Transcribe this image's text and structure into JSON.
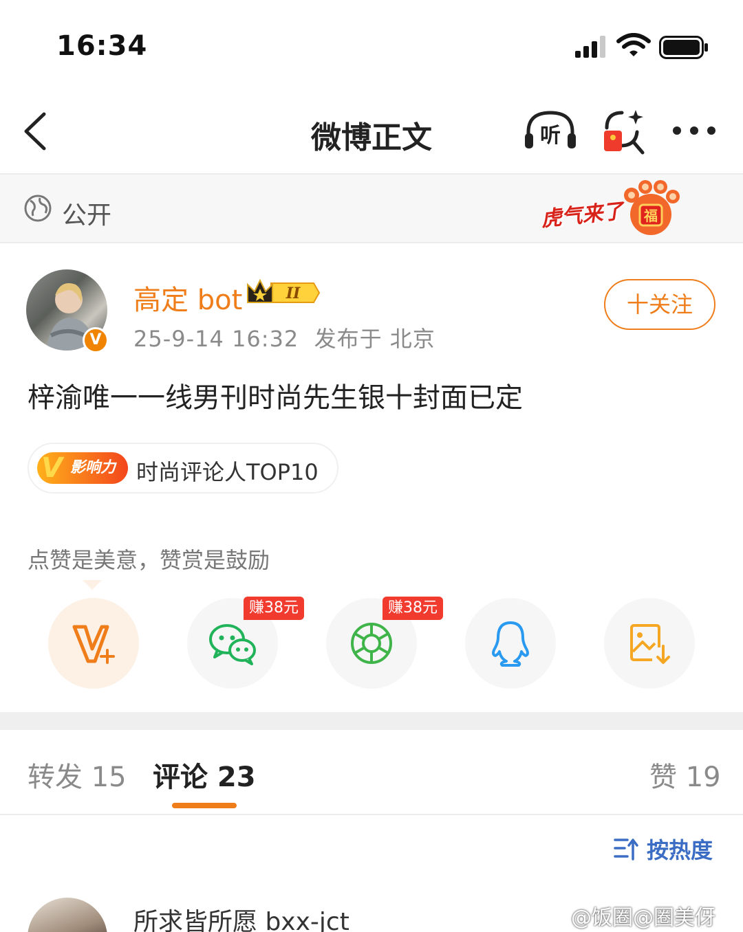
{
  "status_bar": {
    "time": "16:34"
  },
  "nav": {
    "title": "微博正文",
    "listen_label": "听"
  },
  "visibility": {
    "label": "公开",
    "promo_text": "虎气来了",
    "promo_char": "福"
  },
  "author": {
    "name": "高定 bot",
    "avatar_badge": "V",
    "level_badge": "II",
    "meta": "25-9-14 16:32  发布于 北京",
    "follow_label": "十关注"
  },
  "post": {
    "text": "梓渝唯一一线男刊时尚先生银十封面已定",
    "influence_badge_v": "V",
    "influence_badge_label": "影响力",
    "influence_text": "时尚评论人TOP10"
  },
  "reward_hint": "点赞是美意，赞赏是鼓励",
  "share": {
    "wechat_earn": "赚38元",
    "moments_earn": "赚38元",
    "icons": [
      "v-plus-icon",
      "wechat-icon",
      "moments-icon",
      "qq-icon",
      "save-image-icon"
    ]
  },
  "tabs": {
    "repost": "转发 15",
    "comments": "评论 23",
    "likes": "赞 19"
  },
  "sort": {
    "label": "按热度"
  },
  "comment": {
    "username": "所求皆所愿 bxx-jct"
  },
  "watermark": "@饭圈@圈美伢",
  "colors": {
    "accent": "#ef7d19",
    "link_blue": "#3a6dc3",
    "earn_red": "#f23b2f"
  }
}
